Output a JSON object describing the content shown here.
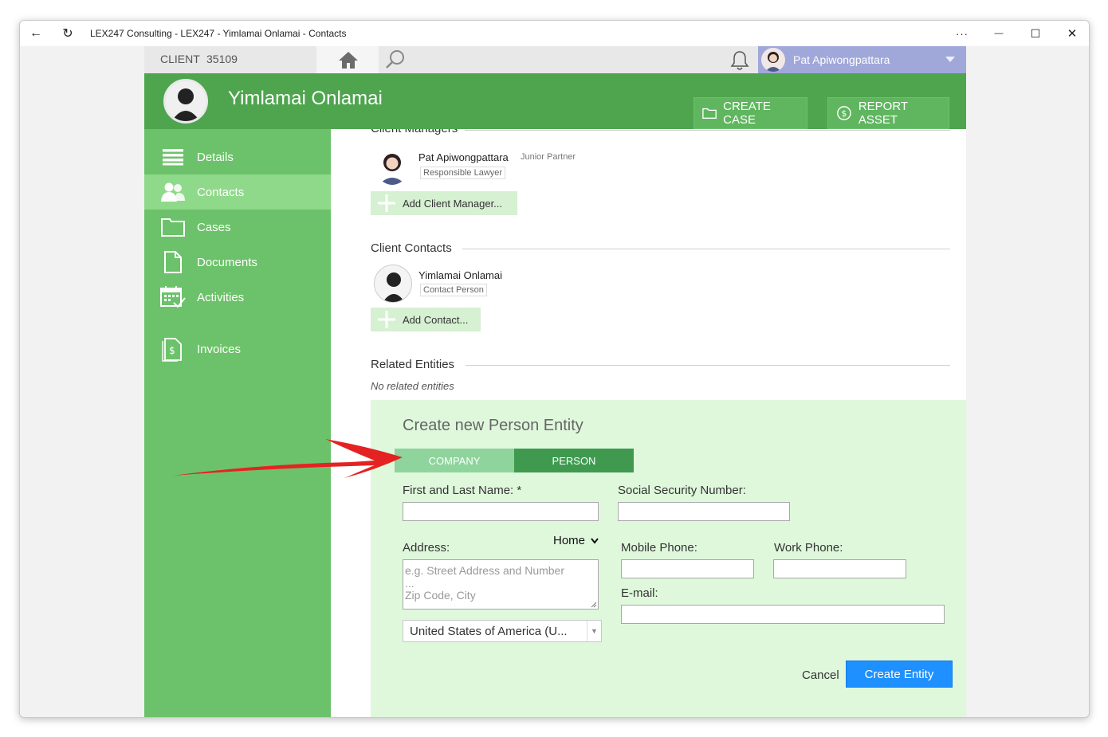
{
  "window": {
    "title": "LEX247 Consulting - LEX247 - Yimlamai Onlamai - Contacts",
    "more_glyph": "···",
    "minimize_glyph": "—",
    "maximize_glyph": "☐",
    "close_glyph": "✕",
    "back_glyph": "←",
    "refresh_glyph": "↻"
  },
  "topbar": {
    "client_label": "CLIENT",
    "client_number": "35109",
    "user_name": "Pat Apiwongpattara"
  },
  "header": {
    "person_name": "Yimlamai Onlamai",
    "create_case_label": "CREATE CASE",
    "report_asset_label": "REPORT ASSET",
    "color": "#4ea54e"
  },
  "sidebar": {
    "items": [
      {
        "label": "Details",
        "icon": "list-icon"
      },
      {
        "label": "Contacts",
        "icon": "contacts-icon"
      },
      {
        "label": "Cases",
        "icon": "folder-icon"
      },
      {
        "label": "Documents",
        "icon": "document-icon"
      },
      {
        "label": "Activities",
        "icon": "calendar-icon"
      },
      {
        "label": "Invoices",
        "icon": "invoice-icon"
      }
    ],
    "active": "Contacts"
  },
  "client_managers": {
    "title": "Client Managers",
    "manager_name": "Pat Apiwongpattara",
    "manager_position": "Junior Partner",
    "manager_role": "Responsible Lawyer",
    "add_label": "Add Client Manager..."
  },
  "client_contacts": {
    "title": "Client Contacts",
    "contact_name": "Yimlamai Onlamai",
    "contact_role": "Contact Person",
    "add_label": "Add Contact..."
  },
  "related_entities": {
    "title": "Related Entities",
    "empty_text": "No related entities"
  },
  "create_entity": {
    "title": "Create new Person Entity",
    "tab_company": "COMPANY",
    "tab_person": "PERSON",
    "selected_tab": "PERSON",
    "name_label": "First and Last Name: *",
    "ssn_label": "Social Security Number:",
    "address_label": "Address:",
    "address_type": "Home",
    "address_placeholder_1": "e.g. Street Address and Number",
    "address_placeholder_2": "...",
    "address_placeholder_3": "Zip Code, City",
    "country": "United States of America (U...",
    "mobile_label": "Mobile Phone:",
    "work_label": "Work Phone:",
    "email_label": "E-mail:",
    "cancel_label": "Cancel",
    "submit_label": "Create Entity"
  }
}
